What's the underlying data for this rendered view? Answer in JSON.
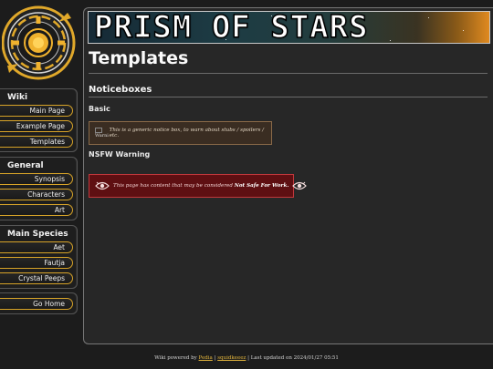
{
  "site": {
    "banner_title": "PRISM OF STARS"
  },
  "sidebar": {
    "sections": [
      {
        "title": "Wiki",
        "links": [
          "Main Page",
          "Example Page",
          "Templates"
        ]
      },
      {
        "title": "General",
        "links": [
          "Synopsis",
          "Characters",
          "Art"
        ]
      },
      {
        "title": "Main Species",
        "links": [
          "Aet",
          "Fautja",
          "Crystal Peeps"
        ]
      }
    ],
    "home_link": "Go Home"
  },
  "page": {
    "title": "Templates",
    "section_heading": "Noticeboxes",
    "basic": {
      "heading": "Basic",
      "img_alt": "Warni",
      "text": "This is a generic notice box, to warn about stubs / spoilers / etc."
    },
    "nsfw": {
      "heading": "NSFW Warning",
      "text_before": "This page has content that may be considered ",
      "text_bold": "Not Safe For Work."
    }
  },
  "footer": {
    "prefix": "Wiki powered by ",
    "link1": "Pedia",
    "sep": " | ",
    "link2": "squidkeeez",
    "suffix": " | Last updated on 2024/01/27 05:51"
  },
  "colors": {
    "accent": "#d8a428",
    "background": "#1c1c1c",
    "panel": "#272727",
    "notice_basic_bg": "#3a2d22",
    "notice_nsfw_bg": "#5e0f12"
  },
  "icons": {
    "logo": "golden-sun-ring-emblem",
    "nsfw": "eye-icon"
  }
}
